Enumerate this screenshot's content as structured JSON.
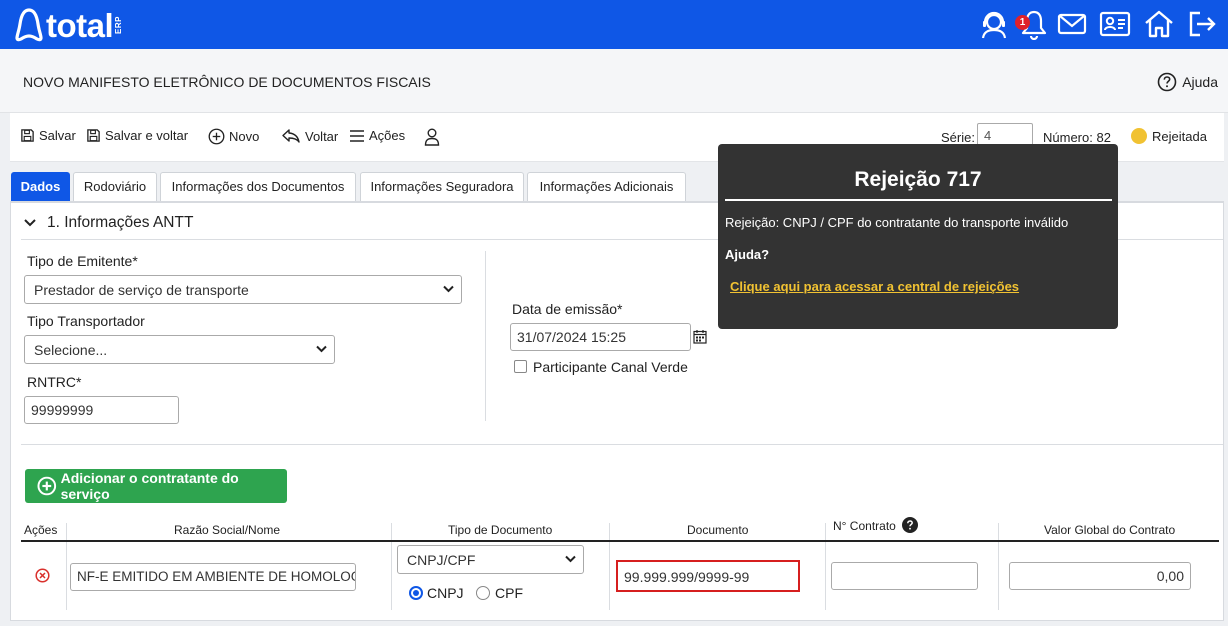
{
  "header": {
    "logo_text": "total",
    "logo_suffix": "ERP",
    "notification_count": "1"
  },
  "page": {
    "title": "NOVO MANIFESTO ELETRÔNICO DE DOCUMENTOS FISCAIS",
    "help_label": "Ajuda"
  },
  "toolbar": {
    "save": "Salvar",
    "save_back": "Salvar e voltar",
    "new": "Novo",
    "back": "Voltar",
    "actions": "Ações",
    "serie_label": "Série:",
    "serie_value": "4",
    "numero": "Número: 82",
    "status": "Rejeitada"
  },
  "tabs": [
    {
      "label": "Dados",
      "active": true
    },
    {
      "label": "Rodoviário"
    },
    {
      "label": "Informações dos Documentos"
    },
    {
      "label": "Informações Seguradora"
    },
    {
      "label": "Informações Adicionais"
    }
  ],
  "section": {
    "title": "1. Informações ANTT"
  },
  "form": {
    "tipo_emitente_label": "Tipo de Emitente*",
    "tipo_emitente_value": "Prestador de serviço de transporte",
    "tipo_transportador_label": "Tipo Transportador",
    "tipo_transportador_value": "Selecione...",
    "rntrc_label": "RNTRC*",
    "rntrc_value": "99999999",
    "data_emissao_label": "Data de emissão*",
    "data_emissao_value": "31/07/2024 15:25",
    "canal_verde_label": "Participante Canal Verde",
    "add_contratante": "Adicionar o contratante do serviço"
  },
  "table": {
    "headers": {
      "acoes": "Ações",
      "razao": "Razão Social/Nome",
      "tipo_doc": "Tipo de Documento",
      "documento": "Documento",
      "contrato": "N° Contrato",
      "valor": "Valor Global do Contrato"
    },
    "row": {
      "razao": "NF-E EMITIDO EM AMBIENTE DE HOMOLOGAÇÃO",
      "tipo_doc": "CNPJ/CPF",
      "radio_cnpj": "CNPJ",
      "radio_cpf": "CPF",
      "documento": "99.999.999/9999-99",
      "contrato": "",
      "valor": "0,00"
    }
  },
  "tooltip": {
    "title": "Rejeição 717",
    "message": "Rejeição: CNPJ / CPF do contratante do transporte inválido",
    "help": "Ajuda?",
    "link": "Clique aqui para acessar a central de rejeições"
  },
  "colors": {
    "brand_blue": "#0f57e6",
    "success_green": "#2ea44f",
    "status_yellow": "#f1c232",
    "error_red": "#e0202a",
    "tooltip_bg": "#333333"
  }
}
